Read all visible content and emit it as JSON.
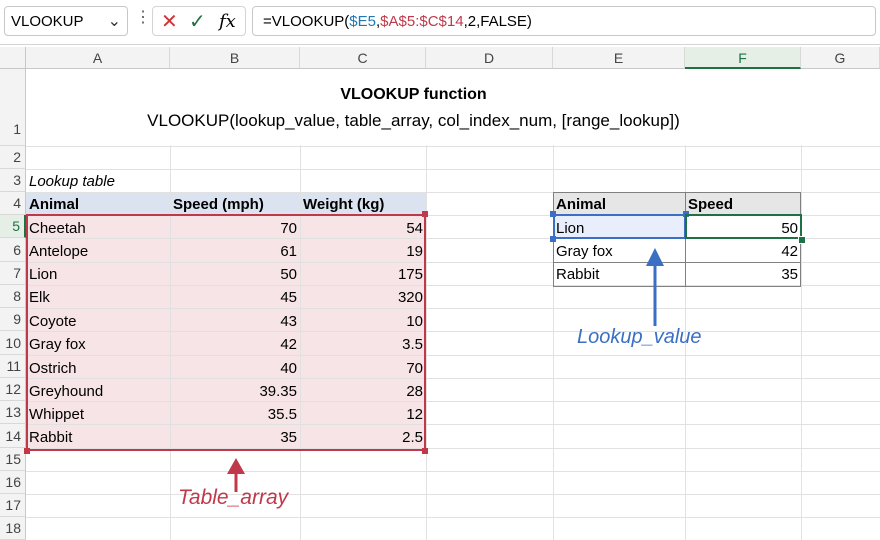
{
  "formula_bar": {
    "name_box": "VLOOKUP",
    "formula_prefix": "=VLOOKUP(",
    "arg1": "$E5",
    "comma1": ",",
    "arg2": "$A$5:$C$14",
    "formula_suffix": ",2,FALSE)",
    "fx_label": "fx"
  },
  "columns": [
    "A",
    "B",
    "C",
    "D",
    "E",
    "F",
    "G"
  ],
  "rows": [
    "1",
    "2",
    "3",
    "4",
    "5",
    "6",
    "7",
    "8",
    "9",
    "10",
    "11",
    "12",
    "13",
    "14",
    "15",
    "16",
    "17",
    "18"
  ],
  "sheet": {
    "title": "VLOOKUP function",
    "syntax": "VLOOKUP(lookup_value, table_array, col_index_num, [range_lookup])",
    "lookup_table_label": "Lookup table",
    "table_headers": [
      "Animal",
      "Speed (mph)",
      "Weight (kg)"
    ],
    "table_rows": [
      {
        "animal": "Cheetah",
        "speed": "70",
        "weight": "54"
      },
      {
        "animal": "Antelope",
        "speed": "61",
        "weight": "19"
      },
      {
        "animal": "Lion",
        "speed": "50",
        "weight": "175"
      },
      {
        "animal": "Elk",
        "speed": "45",
        "weight": "320"
      },
      {
        "animal": "Coyote",
        "speed": "43",
        "weight": "10"
      },
      {
        "animal": "Gray fox",
        "speed": "42",
        "weight": "3.5"
      },
      {
        "animal": "Ostrich",
        "speed": "40",
        "weight": "70"
      },
      {
        "animal": "Greyhound",
        "speed": "39.35",
        "weight": "28"
      },
      {
        "animal": "Whippet",
        "speed": "35.5",
        "weight": "12"
      },
      {
        "animal": "Rabbit",
        "speed": "35",
        "weight": "2.5"
      }
    ],
    "result_headers": [
      "Animal",
      "Speed"
    ],
    "result_rows": [
      {
        "animal": "Lion",
        "speed": "50"
      },
      {
        "animal": "Gray fox",
        "speed": "42"
      },
      {
        "animal": "Rabbit",
        "speed": "35"
      }
    ],
    "annotation_table_array": "Table_array",
    "annotation_lookup_value": "Lookup_value"
  },
  "colors": {
    "table_array_red": "#c0394b",
    "lookup_blue": "#3a6fc4",
    "arg1_color": "#1f77b4",
    "arg2_color": "#c0394b",
    "active_green": "#1e7145"
  }
}
